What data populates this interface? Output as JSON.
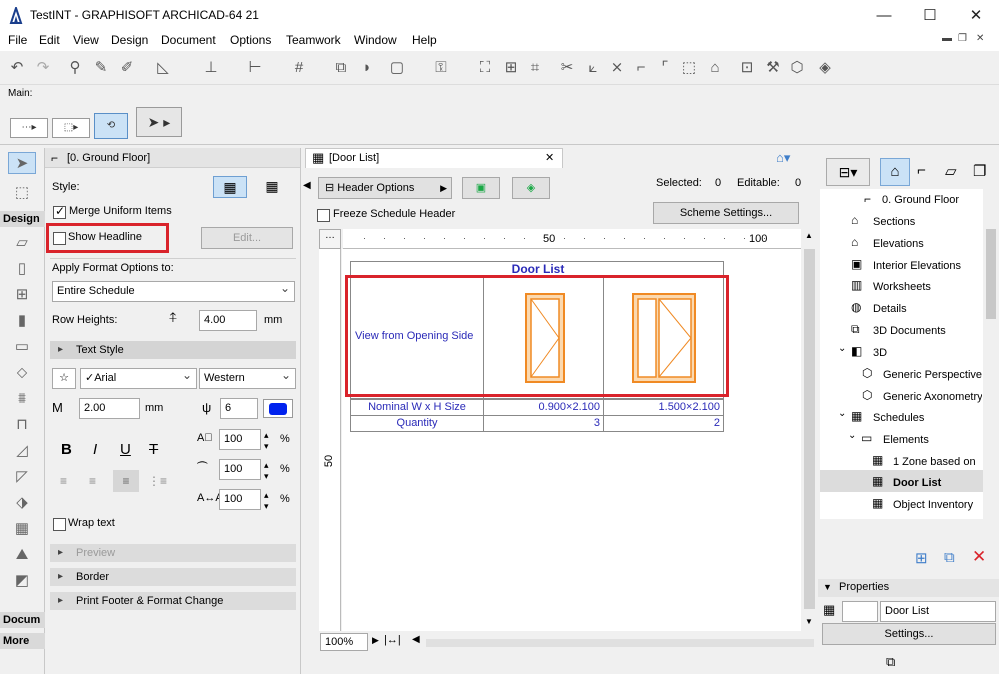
{
  "window": {
    "title": "TestINT - GRAPHISOFT ARCHICAD-64 21",
    "minimize": "—",
    "maximize": "☐",
    "close": "✕"
  },
  "menu": [
    "File",
    "Edit",
    "View",
    "Design",
    "Document",
    "Options",
    "Teamwork",
    "Window",
    "Help"
  ],
  "toolbar": {
    "label": "Main:"
  },
  "toolbox": {
    "design_label": "Design",
    "document_label": "Docum",
    "more_label": "More"
  },
  "settings_panel": {
    "title": "[0. Ground Floor]",
    "style_label": "Style:",
    "merge_label": "Merge Uniform Items",
    "merge_checked": true,
    "show_headline_label": "Show Headline",
    "show_headline_checked": false,
    "edit_button": "Edit...",
    "apply_label": "Apply Format Options to:",
    "apply_value": "Entire Schedule",
    "row_heights_label": "Row Heights:",
    "row_heights_value": "4.00",
    "row_heights_unit": "mm",
    "text_style_label": "Text Style",
    "font_value": "✓Arial",
    "script_value": "Western",
    "size_value": "2.00",
    "size_unit": "mm",
    "pen_value": "6",
    "bold": "B",
    "italic": "I",
    "underline": "U",
    "strike": "T",
    "scale_values": [
      "100",
      "100",
      "100"
    ],
    "percent": "%",
    "wrap_label": "Wrap text",
    "preview_label": "Preview",
    "border_label": "Border",
    "print_footer_label": "Print Footer & Format Change"
  },
  "document": {
    "tab_title": "[Door List]",
    "header_options": "Header Options",
    "selected_label": "Selected:",
    "selected_value": "0",
    "editable_label": "Editable:",
    "editable_value": "0",
    "freeze_label": "Freeze Schedule Header",
    "scheme_button": "Scheme Settings...",
    "ruler_marks": [
      "50",
      "100"
    ],
    "ruler_v_mark": "50",
    "zoom": "100%",
    "schedule": {
      "title": "Door List",
      "view_label": "View from Opening Side",
      "rows": [
        {
          "label": "Nominal W x H Size",
          "values": [
            "0.900×2.100",
            "1.500×2.100"
          ]
        },
        {
          "label": "Quantity",
          "values": [
            "3",
            "2"
          ]
        }
      ]
    }
  },
  "navigator": {
    "items": [
      {
        "label": "0. Ground Floor",
        "level": 2
      },
      {
        "label": "Sections",
        "level": 1
      },
      {
        "label": "Elevations",
        "level": 1
      },
      {
        "label": "Interior Elevations",
        "level": 1
      },
      {
        "label": "Worksheets",
        "level": 1
      },
      {
        "label": "Details",
        "level": 1
      },
      {
        "label": "3D Documents",
        "level": 1
      },
      {
        "label": "3D",
        "level": 1
      },
      {
        "label": "Generic Perspective",
        "level": 2
      },
      {
        "label": "Generic Axonometry",
        "level": 2
      },
      {
        "label": "Schedules",
        "level": 1
      },
      {
        "label": "Elements",
        "level": 2
      },
      {
        "label": "1 Zone based on",
        "level": 3
      },
      {
        "label": "Door List",
        "level": 3
      },
      {
        "label": "Object Inventory",
        "level": 3
      }
    ],
    "properties_label": "Properties",
    "properties_name": "Door List",
    "settings_button": "Settings..."
  },
  "colors": {
    "highlight": "#d9232b",
    "schedule_text": "#2a2ab8",
    "door_orange": "#f08a24",
    "selected_item": "#dcdcdc"
  }
}
